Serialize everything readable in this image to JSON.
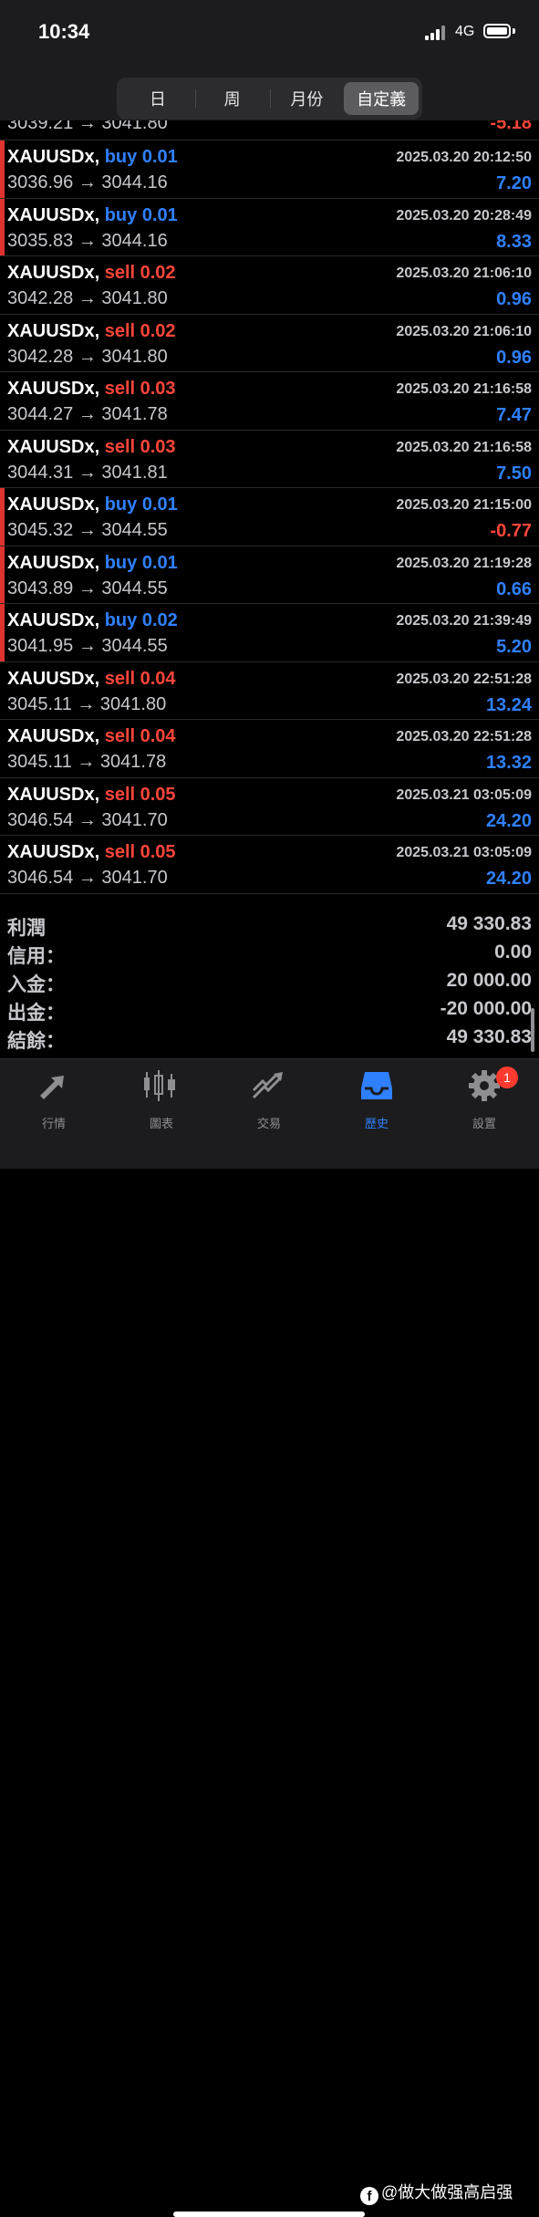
{
  "status_bar": {
    "time": "10:34",
    "network": "4G"
  },
  "period_tabs": [
    "日",
    "周",
    "月份",
    "自定義"
  ],
  "active_period": "自定義",
  "partial_row": {
    "prices": "3039.21 → 3041.80",
    "profit": "-5.18"
  },
  "trades": [
    {
      "symbol": "XAUUSDx,",
      "direction": "buy 0.01",
      "time": "2025.03.20 20:12:50",
      "prices": "3036.96 → 3044.16",
      "profit": "7.20"
    },
    {
      "symbol": "XAUUSDx,",
      "direction": "buy 0.01",
      "time": "2025.03.20 20:28:49",
      "prices": "3035.83 → 3044.16",
      "profit": "8.33"
    },
    {
      "symbol": "XAUUSDx,",
      "direction": "sell 0.02",
      "time": "2025.03.20 21:06:10",
      "prices": "3042.28 → 3041.80",
      "profit": "0.96"
    },
    {
      "symbol": "XAUUSDx,",
      "direction": "sell 0.02",
      "time": "2025.03.20 21:06:10",
      "prices": "3042.28 → 3041.80",
      "profit": "0.96"
    },
    {
      "symbol": "XAUUSDx,",
      "direction": "sell 0.03",
      "time": "2025.03.20 21:16:58",
      "prices": "3044.27 → 3041.78",
      "profit": "7.47"
    },
    {
      "symbol": "XAUUSDx,",
      "direction": "sell 0.03",
      "time": "2025.03.20 21:16:58",
      "prices": "3044.31 → 3041.81",
      "profit": "7.50"
    },
    {
      "symbol": "XAUUSDx,",
      "direction": "buy 0.01",
      "time": "2025.03.20 21:15:00",
      "prices": "3045.32 → 3044.55",
      "profit": "-0.77"
    },
    {
      "symbol": "XAUUSDx,",
      "direction": "buy 0.01",
      "time": "2025.03.20 21:19:28",
      "prices": "3043.89 → 3044.55",
      "profit": "0.66"
    },
    {
      "symbol": "XAUUSDx,",
      "direction": "buy 0.02",
      "time": "2025.03.20 21:39:49",
      "prices": "3041.95 → 3044.55",
      "profit": "5.20"
    },
    {
      "symbol": "XAUUSDx,",
      "direction": "sell 0.04",
      "time": "2025.03.20 22:51:28",
      "prices": "3045.11 → 3041.80",
      "profit": "13.24"
    },
    {
      "symbol": "XAUUSDx,",
      "direction": "sell 0.04",
      "time": "2025.03.20 22:51:28",
      "prices": "3045.11 → 3041.78",
      "profit": "13.32"
    },
    {
      "symbol": "XAUUSDx,",
      "direction": "sell 0.05",
      "time": "2025.03.21 03:05:09",
      "prices": "3046.54 → 3041.70",
      "profit": "24.20"
    },
    {
      "symbol": "XAUUSDx,",
      "direction": "sell 0.05",
      "time": "2025.03.21 03:05:09",
      "prices": "3046.54 → 3041.70",
      "profit": "24.20"
    }
  ],
  "summary": [
    {
      "label": "利潤",
      "value": "49 330.83"
    },
    {
      "label": "信用：",
      "value": "0.00"
    },
    {
      "label": "入金：",
      "value": "20 000.00"
    },
    {
      "label": "出金：",
      "value": "-20 000.00"
    },
    {
      "label": "結餘：",
      "value": "49 330.83"
    }
  ],
  "tabbar": [
    {
      "label": "行情",
      "icon": "quotes-icon"
    },
    {
      "label": "圖表",
      "icon": "chart-icon"
    },
    {
      "label": "交易",
      "icon": "trade-icon"
    },
    {
      "label": "歷史",
      "icon": "history-icon"
    },
    {
      "label": "設置",
      "icon": "settings-icon",
      "badge": "1"
    }
  ],
  "active_tab": "歷史",
  "watermark": "@做大做强高启强",
  "colors": {
    "buy": "#2f80ff",
    "sell": "#ff453a",
    "profit_positive": "#2f80ff",
    "profit_negative": "#ff453a",
    "active_tab": "#2f80ff",
    "buy_marker": "#e0322f"
  }
}
